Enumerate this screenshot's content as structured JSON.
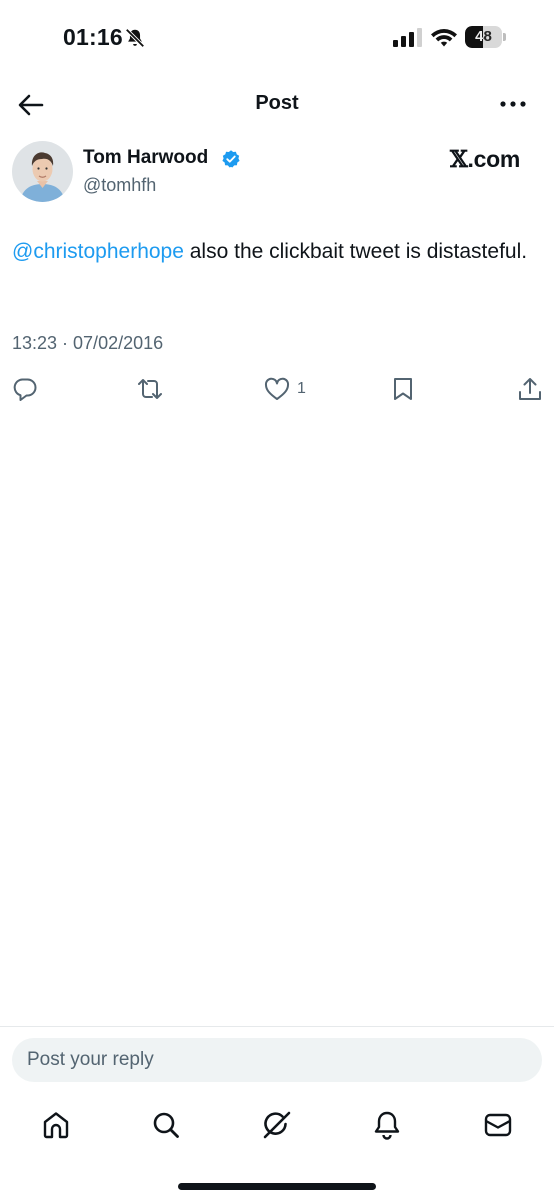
{
  "status_bar": {
    "time": "01:16",
    "battery_level": "48",
    "battery_fraction": 0.48,
    "icons": [
      "bell-off-icon",
      "cellular-signal-icon",
      "wifi-icon",
      "battery-icon"
    ]
  },
  "header": {
    "title": "Post",
    "back_icon": "back-arrow-icon",
    "more_icon": "more-dots-icon"
  },
  "post": {
    "author_name": "Tom Harwood",
    "author_handle": "@tomhfh",
    "verified": true,
    "brand_mark": "𝕏",
    "brand_suffix": ".com",
    "mention": "@christopherhope",
    "text": " also the clickbait tweet is distasteful.",
    "timestamp": "13:23 · 07/02/2016",
    "like_count": "1"
  },
  "actions": {
    "icons": [
      "reply-icon",
      "retweet-icon",
      "like-icon",
      "bookmark-icon",
      "share-icon"
    ]
  },
  "reply": {
    "placeholder": "Post your reply"
  },
  "bottom_nav": {
    "items": [
      "home-icon",
      "search-icon",
      "grok-icon",
      "notifications-icon",
      "messages-icon"
    ]
  },
  "colors": {
    "text": "#0f1419",
    "secondary": "#536471",
    "accent": "#1d9bf0",
    "reply_bg": "#eff3f4"
  }
}
